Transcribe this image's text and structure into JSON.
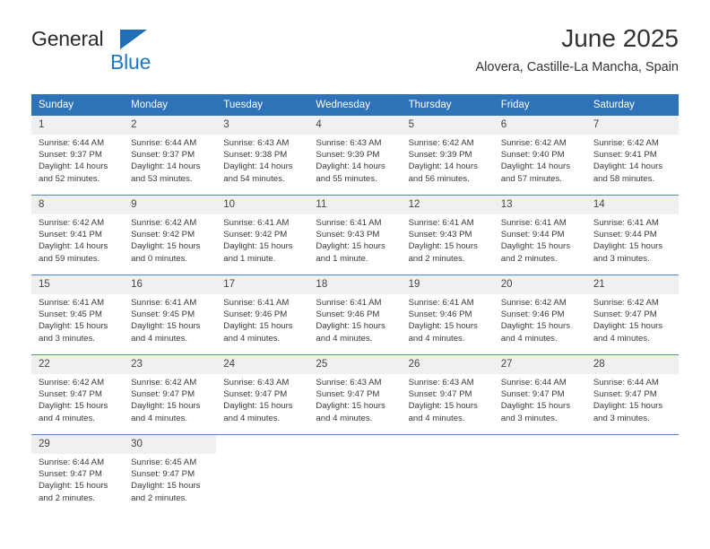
{
  "logo": {
    "word1": "General",
    "word2": "Blue",
    "triangle_color": "#1e6fb5",
    "word2_color": "#1e76c4"
  },
  "header": {
    "title": "June 2025",
    "subtitle": "Alovera, Castille-La Mancha, Spain"
  },
  "theme": {
    "header_blue": "#2e73b8",
    "row_divider": "#4f87c0",
    "daynum_band": "#f0f0f0"
  },
  "calendar": {
    "weekday_headers": [
      "Sunday",
      "Monday",
      "Tuesday",
      "Wednesday",
      "Thursday",
      "Friday",
      "Saturday"
    ],
    "weeks": [
      [
        {
          "day": "1",
          "sunrise": "Sunrise: 6:44 AM",
          "sunset": "Sunset: 9:37 PM",
          "daylight_line1": "Daylight: 14 hours",
          "daylight_line2": "and 52 minutes."
        },
        {
          "day": "2",
          "sunrise": "Sunrise: 6:44 AM",
          "sunset": "Sunset: 9:37 PM",
          "daylight_line1": "Daylight: 14 hours",
          "daylight_line2": "and 53 minutes."
        },
        {
          "day": "3",
          "sunrise": "Sunrise: 6:43 AM",
          "sunset": "Sunset: 9:38 PM",
          "daylight_line1": "Daylight: 14 hours",
          "daylight_line2": "and 54 minutes."
        },
        {
          "day": "4",
          "sunrise": "Sunrise: 6:43 AM",
          "sunset": "Sunset: 9:39 PM",
          "daylight_line1": "Daylight: 14 hours",
          "daylight_line2": "and 55 minutes."
        },
        {
          "day": "5",
          "sunrise": "Sunrise: 6:42 AM",
          "sunset": "Sunset: 9:39 PM",
          "daylight_line1": "Daylight: 14 hours",
          "daylight_line2": "and 56 minutes."
        },
        {
          "day": "6",
          "sunrise": "Sunrise: 6:42 AM",
          "sunset": "Sunset: 9:40 PM",
          "daylight_line1": "Daylight: 14 hours",
          "daylight_line2": "and 57 minutes."
        },
        {
          "day": "7",
          "sunrise": "Sunrise: 6:42 AM",
          "sunset": "Sunset: 9:41 PM",
          "daylight_line1": "Daylight: 14 hours",
          "daylight_line2": "and 58 minutes."
        }
      ],
      [
        {
          "day": "8",
          "sunrise": "Sunrise: 6:42 AM",
          "sunset": "Sunset: 9:41 PM",
          "daylight_line1": "Daylight: 14 hours",
          "daylight_line2": "and 59 minutes."
        },
        {
          "day": "9",
          "sunrise": "Sunrise: 6:42 AM",
          "sunset": "Sunset: 9:42 PM",
          "daylight_line1": "Daylight: 15 hours",
          "daylight_line2": "and 0 minutes."
        },
        {
          "day": "10",
          "sunrise": "Sunrise: 6:41 AM",
          "sunset": "Sunset: 9:42 PM",
          "daylight_line1": "Daylight: 15 hours",
          "daylight_line2": "and 1 minute."
        },
        {
          "day": "11",
          "sunrise": "Sunrise: 6:41 AM",
          "sunset": "Sunset: 9:43 PM",
          "daylight_line1": "Daylight: 15 hours",
          "daylight_line2": "and 1 minute."
        },
        {
          "day": "12",
          "sunrise": "Sunrise: 6:41 AM",
          "sunset": "Sunset: 9:43 PM",
          "daylight_line1": "Daylight: 15 hours",
          "daylight_line2": "and 2 minutes."
        },
        {
          "day": "13",
          "sunrise": "Sunrise: 6:41 AM",
          "sunset": "Sunset: 9:44 PM",
          "daylight_line1": "Daylight: 15 hours",
          "daylight_line2": "and 2 minutes."
        },
        {
          "day": "14",
          "sunrise": "Sunrise: 6:41 AM",
          "sunset": "Sunset: 9:44 PM",
          "daylight_line1": "Daylight: 15 hours",
          "daylight_line2": "and 3 minutes."
        }
      ],
      [
        {
          "day": "15",
          "sunrise": "Sunrise: 6:41 AM",
          "sunset": "Sunset: 9:45 PM",
          "daylight_line1": "Daylight: 15 hours",
          "daylight_line2": "and 3 minutes."
        },
        {
          "day": "16",
          "sunrise": "Sunrise: 6:41 AM",
          "sunset": "Sunset: 9:45 PM",
          "daylight_line1": "Daylight: 15 hours",
          "daylight_line2": "and 4 minutes."
        },
        {
          "day": "17",
          "sunrise": "Sunrise: 6:41 AM",
          "sunset": "Sunset: 9:46 PM",
          "daylight_line1": "Daylight: 15 hours",
          "daylight_line2": "and 4 minutes."
        },
        {
          "day": "18",
          "sunrise": "Sunrise: 6:41 AM",
          "sunset": "Sunset: 9:46 PM",
          "daylight_line1": "Daylight: 15 hours",
          "daylight_line2": "and 4 minutes."
        },
        {
          "day": "19",
          "sunrise": "Sunrise: 6:41 AM",
          "sunset": "Sunset: 9:46 PM",
          "daylight_line1": "Daylight: 15 hours",
          "daylight_line2": "and 4 minutes."
        },
        {
          "day": "20",
          "sunrise": "Sunrise: 6:42 AM",
          "sunset": "Sunset: 9:46 PM",
          "daylight_line1": "Daylight: 15 hours",
          "daylight_line2": "and 4 minutes."
        },
        {
          "day": "21",
          "sunrise": "Sunrise: 6:42 AM",
          "sunset": "Sunset: 9:47 PM",
          "daylight_line1": "Daylight: 15 hours",
          "daylight_line2": "and 4 minutes."
        }
      ],
      [
        {
          "day": "22",
          "sunrise": "Sunrise: 6:42 AM",
          "sunset": "Sunset: 9:47 PM",
          "daylight_line1": "Daylight: 15 hours",
          "daylight_line2": "and 4 minutes."
        },
        {
          "day": "23",
          "sunrise": "Sunrise: 6:42 AM",
          "sunset": "Sunset: 9:47 PM",
          "daylight_line1": "Daylight: 15 hours",
          "daylight_line2": "and 4 minutes."
        },
        {
          "day": "24",
          "sunrise": "Sunrise: 6:43 AM",
          "sunset": "Sunset: 9:47 PM",
          "daylight_line1": "Daylight: 15 hours",
          "daylight_line2": "and 4 minutes."
        },
        {
          "day": "25",
          "sunrise": "Sunrise: 6:43 AM",
          "sunset": "Sunset: 9:47 PM",
          "daylight_line1": "Daylight: 15 hours",
          "daylight_line2": "and 4 minutes."
        },
        {
          "day": "26",
          "sunrise": "Sunrise: 6:43 AM",
          "sunset": "Sunset: 9:47 PM",
          "daylight_line1": "Daylight: 15 hours",
          "daylight_line2": "and 4 minutes."
        },
        {
          "day": "27",
          "sunrise": "Sunrise: 6:44 AM",
          "sunset": "Sunset: 9:47 PM",
          "daylight_line1": "Daylight: 15 hours",
          "daylight_line2": "and 3 minutes."
        },
        {
          "day": "28",
          "sunrise": "Sunrise: 6:44 AM",
          "sunset": "Sunset: 9:47 PM",
          "daylight_line1": "Daylight: 15 hours",
          "daylight_line2": "and 3 minutes."
        }
      ],
      [
        {
          "day": "29",
          "sunrise": "Sunrise: 6:44 AM",
          "sunset": "Sunset: 9:47 PM",
          "daylight_line1": "Daylight: 15 hours",
          "daylight_line2": "and 2 minutes."
        },
        {
          "day": "30",
          "sunrise": "Sunrise: 6:45 AM",
          "sunset": "Sunset: 9:47 PM",
          "daylight_line1": "Daylight: 15 hours",
          "daylight_line2": "and 2 minutes."
        },
        {
          "day": "",
          "sunrise": "",
          "sunset": "",
          "daylight_line1": "",
          "daylight_line2": ""
        },
        {
          "day": "",
          "sunrise": "",
          "sunset": "",
          "daylight_line1": "",
          "daylight_line2": ""
        },
        {
          "day": "",
          "sunrise": "",
          "sunset": "",
          "daylight_line1": "",
          "daylight_line2": ""
        },
        {
          "day": "",
          "sunrise": "",
          "sunset": "",
          "daylight_line1": "",
          "daylight_line2": ""
        },
        {
          "day": "",
          "sunrise": "",
          "sunset": "",
          "daylight_line1": "",
          "daylight_line2": ""
        }
      ]
    ]
  }
}
